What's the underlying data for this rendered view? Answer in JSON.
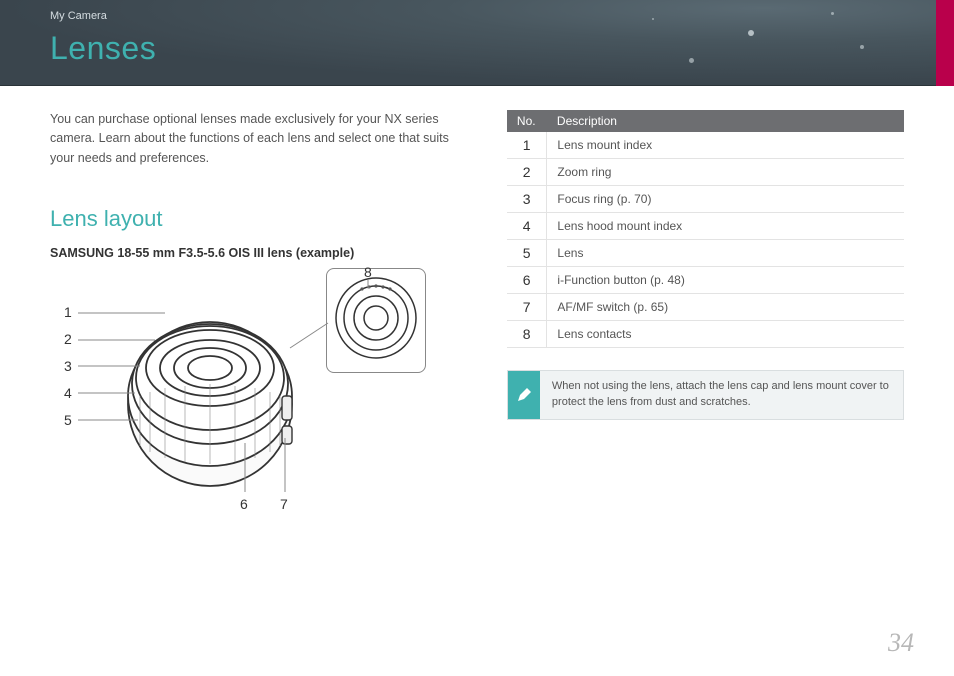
{
  "header": {
    "breadcrumb": "My Camera",
    "title": "Lenses"
  },
  "intro": "You can purchase optional lenses made exclusively for your NX series camera. Learn about the functions of each lens and select one that suits your needs and preferences.",
  "section_title": "Lens layout",
  "lens_name": "SAMSUNG 18-55 mm F3.5-5.6 OIS III lens (example)",
  "callouts": {
    "n1": "1",
    "n2": "2",
    "n3": "3",
    "n4": "4",
    "n5": "5",
    "n6": "6",
    "n7": "7",
    "n8": "8"
  },
  "table": {
    "header_no": "No.",
    "header_desc": "Description",
    "rows": [
      {
        "no": "1",
        "desc": "Lens mount index"
      },
      {
        "no": "2",
        "desc": "Zoom ring"
      },
      {
        "no": "3",
        "desc": "Focus ring (p. 70)"
      },
      {
        "no": "4",
        "desc": "Lens hood mount index"
      },
      {
        "no": "5",
        "desc": "Lens"
      },
      {
        "no": "6",
        "desc": "i-Function button (p. 48)"
      },
      {
        "no": "7",
        "desc": "AF/MF switch (p. 65)"
      },
      {
        "no": "8",
        "desc": "Lens contacts"
      }
    ]
  },
  "note": "When not using the lens, attach the lens cap and lens mount cover to protect the lens from dust and scratches.",
  "page_number": "34"
}
